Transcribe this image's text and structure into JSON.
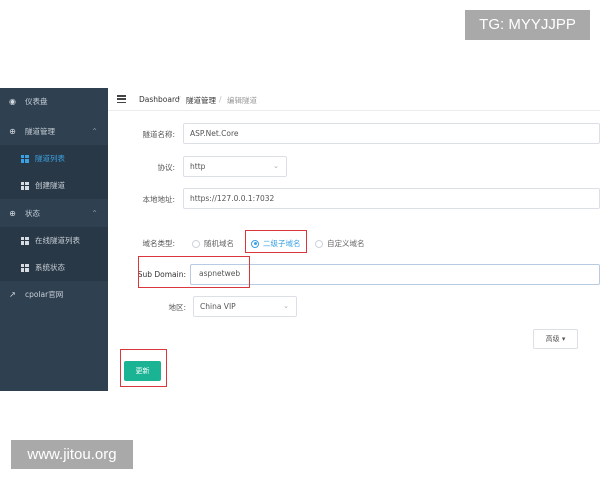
{
  "watermarks": {
    "top": "TG: MYYJJPP",
    "bottom": "www.jitou.org"
  },
  "sidebar": {
    "items": [
      {
        "label": "仪表盘",
        "icon": "dashboard-icon"
      },
      {
        "label": "隧道管理",
        "icon": "plus-circle-icon"
      },
      {
        "label": "隧道列表",
        "icon": "grid-icon"
      },
      {
        "label": "创建隧道",
        "icon": "grid-icon"
      },
      {
        "label": "状态",
        "icon": "plus-circle-icon"
      },
      {
        "label": "在线隧道列表",
        "icon": "grid-icon"
      },
      {
        "label": "系统状态",
        "icon": "grid-icon"
      },
      {
        "label": "cpolar官网",
        "icon": "external-link-icon"
      }
    ]
  },
  "breadcrumb": {
    "items": [
      "Dashboard",
      "隧道管理",
      "编辑隧道"
    ]
  },
  "form": {
    "name_label": "隧道名称:",
    "name_value": "ASP.Net.Core",
    "protocol_label": "协议:",
    "protocol_value": "http",
    "address_label": "本地地址:",
    "address_value": "https://127.0.0.1:7032",
    "domain_type_label": "域名类型:",
    "domain_type_options": [
      "随机域名",
      "二级子域名",
      "自定义域名"
    ],
    "domain_type_selected": "二级子域名",
    "subdomain_label": "Sub Domain:",
    "subdomain_value": "aspnetweb",
    "region_label": "地区:",
    "region_value": "China VIP"
  },
  "buttons": {
    "advanced": "高级",
    "save": "更新"
  },
  "colors": {
    "sidebar": "#2f4050",
    "accent": "#3aa1e3",
    "save": "#1ab394",
    "highlight": "#d9363e"
  }
}
